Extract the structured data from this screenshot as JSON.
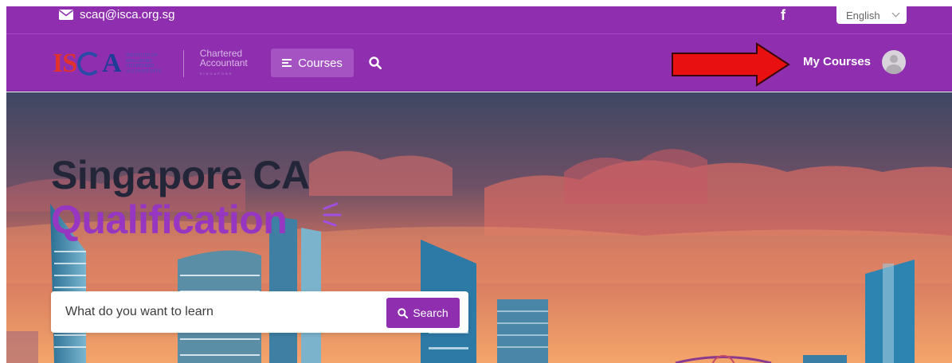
{
  "topbar": {
    "email": "scaq@isca.org.sg",
    "facebook_glyph": "f",
    "language": "English"
  },
  "nav": {
    "logo": {
      "letters_left": "IS",
      "letters_right": "A",
      "subtext": "INSTITUTE OF SINGAPORE CHARTERED ACCOUNTANTS",
      "ca_line1": "Chartered",
      "ca_line2": "Accountant",
      "ca_small": "SINGAPORE"
    },
    "courses_label": "Courses",
    "my_courses_label": "My Courses"
  },
  "hero": {
    "title_line1": "Singapore CA",
    "title_line2": "Qualification",
    "search_placeholder": "What do you want to learn",
    "search_button": "Search"
  },
  "colors": {
    "brand_purple": "#8f2fb0",
    "annotation_red": "#e81010",
    "title_dark": "#232639",
    "title_purple": "#9736c0"
  },
  "icons": {
    "email": "envelope-icon",
    "facebook": "facebook-icon",
    "language": "chevron-down-icon",
    "courses": "menu-icon",
    "nav_search": "search-icon",
    "annotation": "arrow-right-icon",
    "avatar": "user-avatar-icon"
  }
}
